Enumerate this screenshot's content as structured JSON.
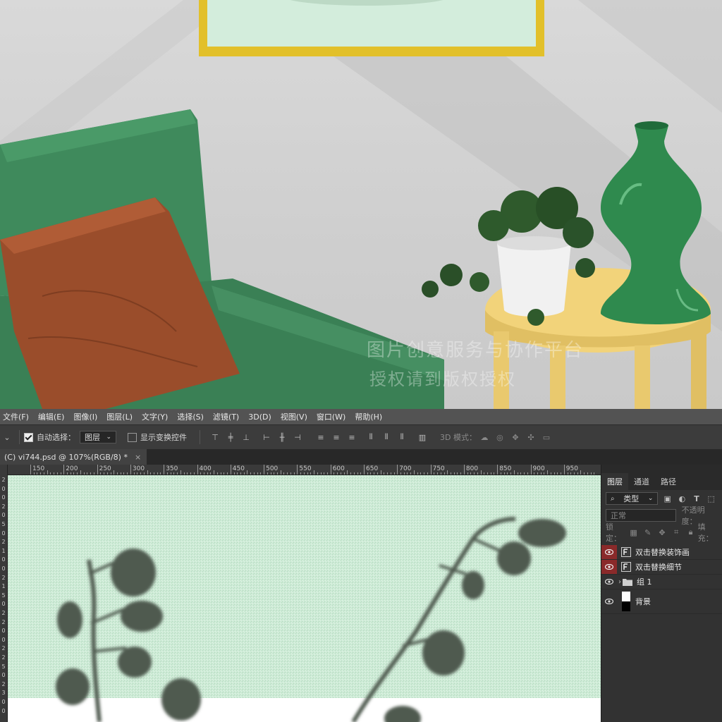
{
  "watermark": {
    "line1": "图片创意服务与协作平台",
    "line2": "授权请到版权授权"
  },
  "menubar": {
    "items": [
      "文件(F)",
      "编辑(E)",
      "图像(I)",
      "图层(L)",
      "文字(Y)",
      "选择(S)",
      "滤镜(T)",
      "3D(D)",
      "视图(V)",
      "窗口(W)",
      "帮助(H)"
    ]
  },
  "options": {
    "auto_select_label": "自动选择：",
    "auto_select_checked": true,
    "auto_select_target": "图层",
    "show_transform_label": "显示变换控件",
    "show_transform_checked": false,
    "mode_3d_label": "3D 模式："
  },
  "document": {
    "tab_title": "(C) vi744.psd @ 107%(RGB/8) *",
    "close_glyph": "×"
  },
  "ruler": {
    "h_labels": [
      "150",
      "200",
      "250",
      "300",
      "350",
      "400",
      "450",
      "500",
      "550",
      "600",
      "650",
      "700",
      "750",
      "800",
      "850",
      "900",
      "950"
    ],
    "v_labels": [
      "2",
      "0",
      "0",
      "2",
      "0",
      "5",
      "0",
      "2",
      "1",
      "0",
      "0",
      "2",
      "1",
      "5",
      "0",
      "2",
      "2",
      "0",
      "0",
      "2",
      "2",
      "5",
      "0",
      "2",
      "3",
      "0",
      "0"
    ]
  },
  "layers_panel": {
    "tabs": [
      "图层",
      "通道",
      "路径"
    ],
    "active_tab": "图层",
    "filter_label": "类型",
    "blend_mode": "正常",
    "opacity_label": "不透明度：",
    "lock_label": "锁定：",
    "fill_label": "填充：",
    "layers": [
      {
        "name": "双击替换装饰画",
        "type": "smart",
        "highlighted": true
      },
      {
        "name": "双击替换细节",
        "type": "smart",
        "highlighted": true
      },
      {
        "name": "组 1",
        "type": "group",
        "highlighted": false
      },
      {
        "name": "背景",
        "type": "background",
        "highlighted": false
      }
    ]
  },
  "colors": {
    "menubar_bg": "#535353",
    "canvas_green": "#cdebd6",
    "leaf_shadow": "#4f5a50",
    "eye_highlight": "#8a2a2a"
  }
}
